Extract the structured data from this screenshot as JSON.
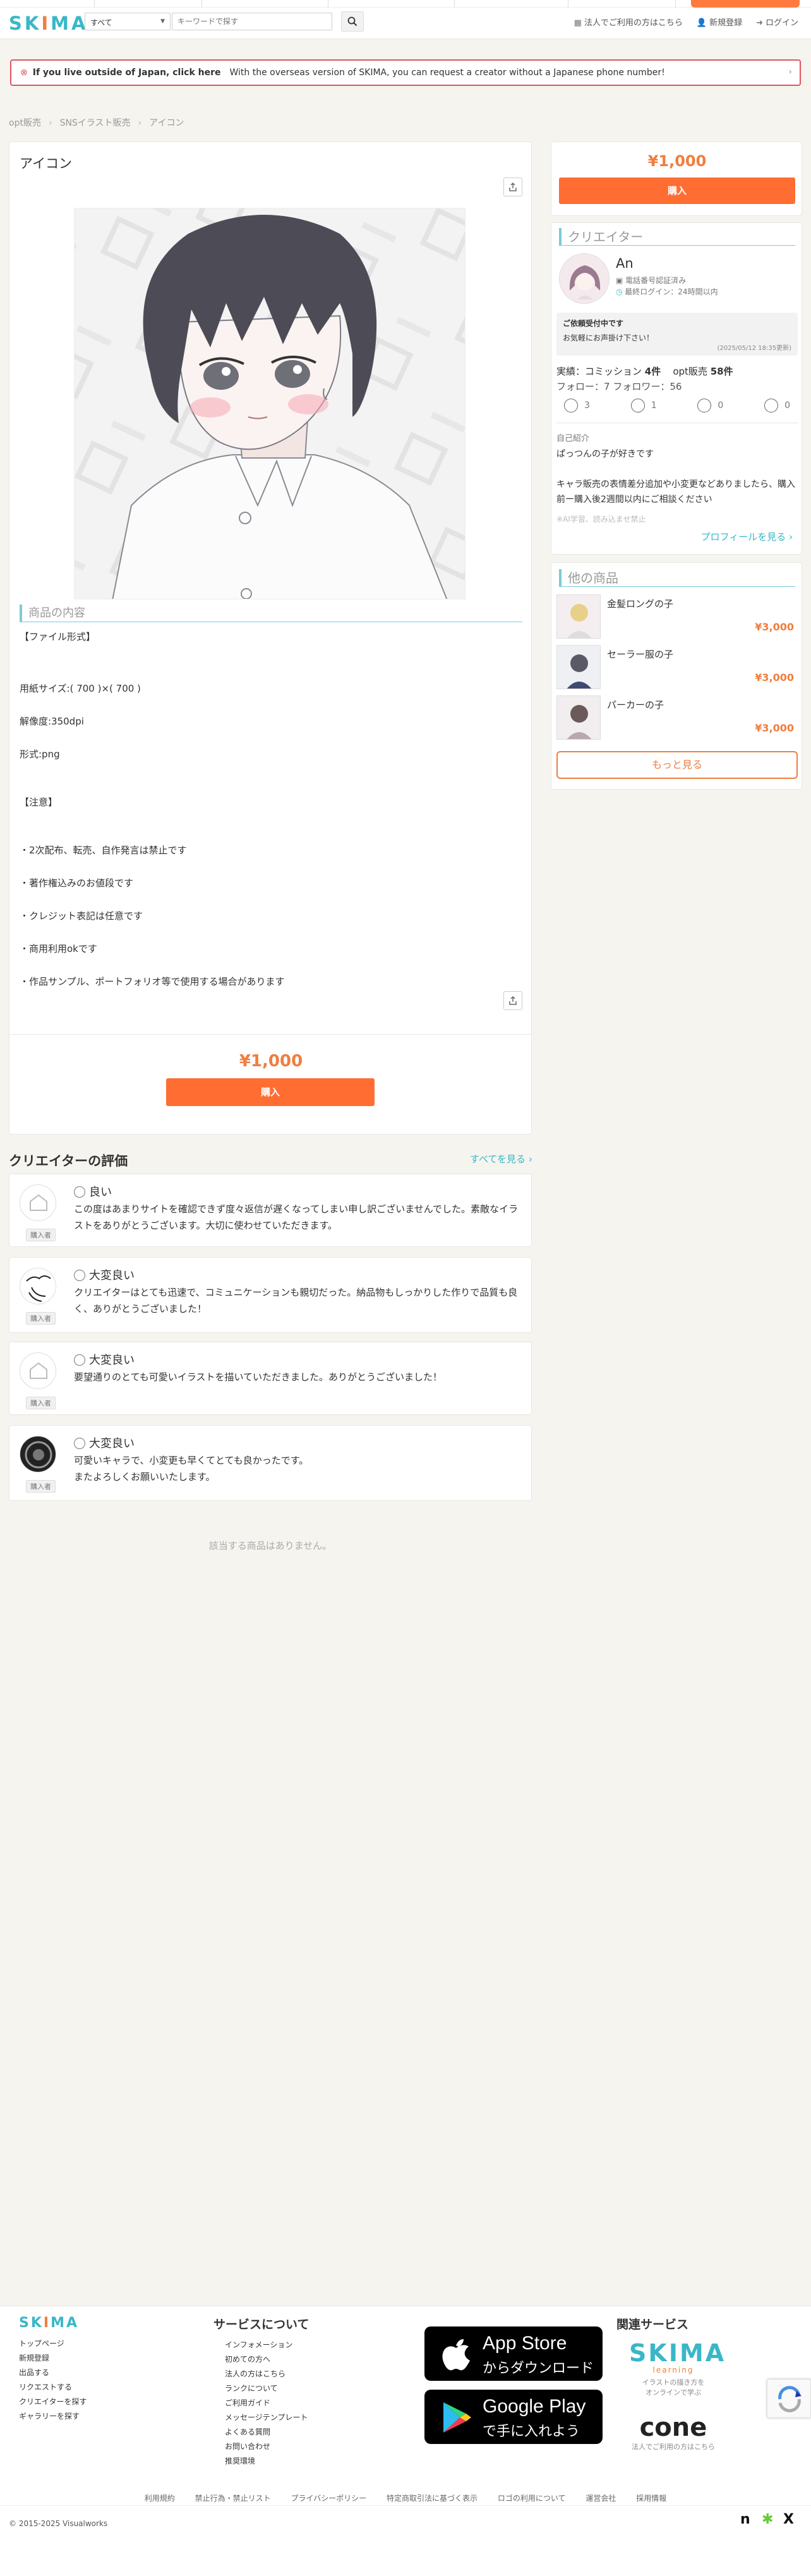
{
  "header": {
    "logo_part1": "SK",
    "logo_part2": "I",
    "logo_part3": "MA",
    "category_select": "すべて",
    "search_placeholder": "キーワードで探す",
    "links": [
      "法人でご利用の方はこちら",
      "新規登録",
      "ログイン"
    ]
  },
  "notice": {
    "bold": "If you live outside of Japan, click here",
    "text": "With the overseas version of SKIMA, you can request a creator without a Japanese phone number!"
  },
  "breadcrumb": [
    "opt販売",
    "SNSイラスト販売",
    "アイコン"
  ],
  "product": {
    "title": "アイコン",
    "section_heading": "商品の内容",
    "description": [
      "【ファイル形式】",
      "",
      "用紙サイズ:( 700 )×( 700 )",
      "解像度:350dpi",
      "形式:png",
      "",
      "【注意】",
      "",
      "・2次配布、転売、自作発言は禁止です",
      "・著作権込みのお値段です",
      "・クレジット表記は任意です",
      "・商用利用okです",
      "・作品サンプル、ポートフォリオ等で使用する場合があります"
    ],
    "price": "¥1,000",
    "buy_label": "購入"
  },
  "side_buy": {
    "price": "¥1,000",
    "buy_label": "購入"
  },
  "creator": {
    "heading": "クリエイター",
    "name": "An",
    "verified": "電話番号認証済み",
    "last_login": "最終ログイン：24時間以内",
    "note_title": "ご依頼受付中です",
    "note_body": "お気軽にお声掛け下さい！",
    "note_date": "(2025/05/12 18:35更新)",
    "stats_line1_a": "実績：コミッション",
    "stats_commission": "4件",
    "stats_line1_b": "opt販売",
    "stats_opt": "58件",
    "follow_label": "フォロー：",
    "follow": "7",
    "follower_label": "フォロワー：",
    "follower": "56",
    "ratings": [
      "3",
      "1",
      "0",
      "0"
    ],
    "intro_label": "自己紹介",
    "intro1": "ぱっつんの子が好きです",
    "intro2": "キャラ販売の表情差分追加や小変更などありましたら、購入前ー購入後2週間以内にご相談ください",
    "intro_fade": "※AI学習、読み込ませ禁止",
    "profile_link": "プロフィールを見る ›"
  },
  "other": {
    "heading": "他の商品",
    "items": [
      {
        "name": "金髪ロングの子",
        "price": "¥3,000"
      },
      {
        "name": "セーラー服の子",
        "price": "¥3,000"
      },
      {
        "name": "パーカーの子",
        "price": "¥3,000"
      }
    ],
    "more": "もっと見る"
  },
  "reviews": {
    "title": "クリエイターの評価",
    "more": "すべてを見る ›",
    "tag": "購入者",
    "items": [
      {
        "rating": "良い",
        "text": "この度はあまりサイトを確認できず度々返信が遅くなってしまい申し訳ございませんでした。素敵なイラストをありがとうございます。大切に使わせていただきます。"
      },
      {
        "rating": "大変良い",
        "text": "クリエイターはとても迅速で、コミュニケーションも親切だった。納品物もしっかりした作りで品質も良く、ありがとうございました！"
      },
      {
        "rating": "大変良い",
        "text": "要望通りのとても可愛いイラストを描いていただきました。ありがとうございました！"
      },
      {
        "rating": "大変良い",
        "text": "可愛いキャラで、小変更も早くてとても良かったです。\nまたよろしくお願いいたします。"
      }
    ]
  },
  "no_items": "該当する商品はありません。",
  "footer": {
    "links_col1": [
      "トップページ",
      "新規登録",
      "出品する",
      "リクエストする",
      "クリエイターを探す",
      "ギャラリーを探す"
    ],
    "services_heading": "サービスについて",
    "links_col2": [
      "インフォメーション",
      "初めての方へ",
      "法人の方はこちら",
      "ランクについて",
      "ご利用ガイド",
      "メッセージテンプレート",
      "よくある質問",
      "お問い合わせ",
      "推奨環境"
    ],
    "appstore_l1": "App Store",
    "appstore_l2": "からダウンロード",
    "gplay_l1": "Google Play",
    "gplay_l2": "で手に入れよう",
    "related_heading": "関連サービス",
    "skima_learning": "learning",
    "skima_learning_sub1": "イラストの描き方を",
    "skima_learning_sub2": "オンラインで学ぶ",
    "cone": "cone",
    "cone_sub": "法人でご利用の方はこちら",
    "bottom_links": [
      "利用規約",
      "禁止行為・禁止リスト",
      "プライバシーポリシー",
      "特定商取引法に基づく表示",
      "ロゴの利用について",
      "運営会社",
      "採用情報"
    ],
    "copyright": "© 2015-2025 Visualworks"
  }
}
